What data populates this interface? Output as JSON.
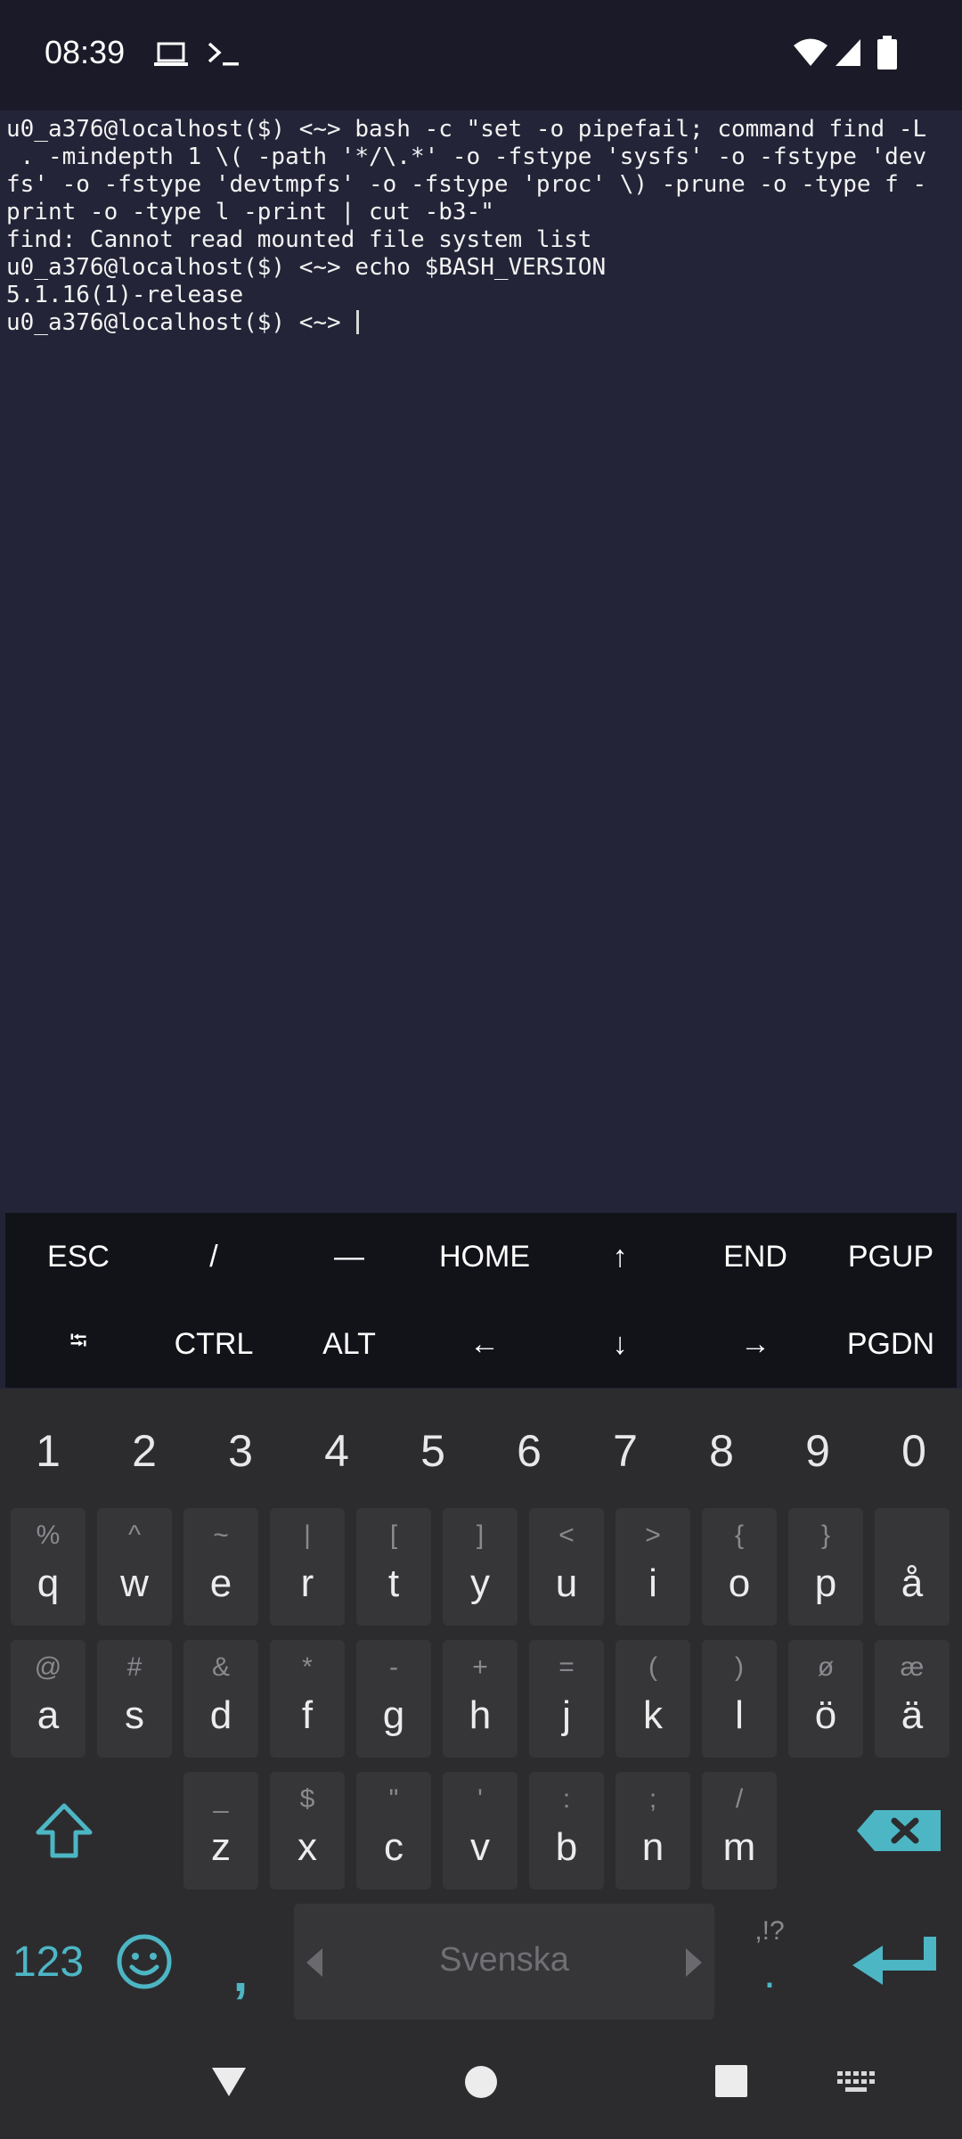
{
  "status_bar": {
    "time": "08:39",
    "icons": [
      "laptop-icon",
      "terminal-icon",
      "wifi-icon",
      "signal-icon",
      "battery-icon"
    ]
  },
  "terminal": {
    "lines": [
      "u0_a376@localhost($) <~> bash -c \"set -o pipefail; command find -L",
      " . -mindepth 1 \\( -path '*/\\.*' -o -fstype 'sysfs' -o -fstype 'dev",
      "fs' -o -fstype 'devtmpfs' -o -fstype 'proc' \\) -prune -o -type f -",
      "print -o -type l -print | cut -b3-\"",
      "find: Cannot read mounted file system list",
      "u0_a376@localhost($) <~> echo $BASH_VERSION",
      "5.1.16(1)-release",
      "u0_a376@localhost($) <~> "
    ]
  },
  "extra_keys": {
    "row1": [
      "ESC",
      "/",
      "—",
      "HOME",
      "↑",
      "END",
      "PGUP"
    ],
    "row2": [
      "⭾",
      "CTRL",
      "ALT",
      "←",
      "↓",
      "→",
      "PGDN"
    ]
  },
  "keyboard": {
    "numbers": [
      "1",
      "2",
      "3",
      "4",
      "5",
      "6",
      "7",
      "8",
      "9",
      "0"
    ],
    "row1": [
      {
        "main": "q",
        "alt": "%"
      },
      {
        "main": "w",
        "alt": "^"
      },
      {
        "main": "e",
        "alt": "~"
      },
      {
        "main": "r",
        "alt": "|"
      },
      {
        "main": "t",
        "alt": "["
      },
      {
        "main": "y",
        "alt": "]"
      },
      {
        "main": "u",
        "alt": "<"
      },
      {
        "main": "i",
        "alt": ">"
      },
      {
        "main": "o",
        "alt": "{"
      },
      {
        "main": "p",
        "alt": "}"
      },
      {
        "main": "å",
        "alt": ""
      }
    ],
    "row2": [
      {
        "main": "a",
        "alt": "@"
      },
      {
        "main": "s",
        "alt": "#"
      },
      {
        "main": "d",
        "alt": "&"
      },
      {
        "main": "f",
        "alt": "*"
      },
      {
        "main": "g",
        "alt": "-"
      },
      {
        "main": "h",
        "alt": "+"
      },
      {
        "main": "j",
        "alt": "="
      },
      {
        "main": "k",
        "alt": "("
      },
      {
        "main": "l",
        "alt": ")"
      },
      {
        "main": "ö",
        "alt": "ø"
      },
      {
        "main": "ä",
        "alt": "æ"
      }
    ],
    "row3": [
      {
        "main": "z",
        "alt": "_"
      },
      {
        "main": "x",
        "alt": "$"
      },
      {
        "main": "c",
        "alt": "\""
      },
      {
        "main": "v",
        "alt": "'"
      },
      {
        "main": "b",
        "alt": ":"
      },
      {
        "main": "n",
        "alt": ";"
      },
      {
        "main": "m",
        "alt": "/"
      }
    ],
    "symbols_label": "123",
    "comma_label": ",",
    "space_label": "Svenska",
    "period_label": ".",
    "period_alt": ",!?",
    "accent_color": "#4db6c4"
  },
  "nav_bar": {
    "icons": [
      "back-icon",
      "home-icon",
      "recents-icon",
      "keyboard-switch-icon"
    ]
  }
}
